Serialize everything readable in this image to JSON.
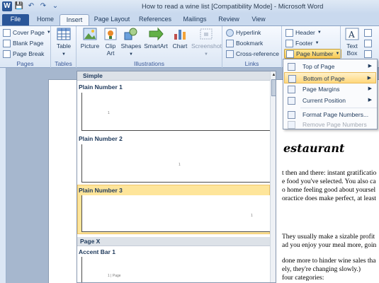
{
  "window": {
    "title": "How to read a wine list [Compatibility Mode] - Microsoft Word"
  },
  "qat": {
    "logo": "W",
    "save": "💾",
    "undo": "↶",
    "redo": "↷",
    "more": "⌄"
  },
  "tabs": [
    "File",
    "Home",
    "Insert",
    "Page Layout",
    "References",
    "Mailings",
    "Review",
    "View"
  ],
  "ribbon": {
    "pages": {
      "cover_page": "Cover Page",
      "blank_page": "Blank Page",
      "page_break": "Page Break",
      "label": "Pages"
    },
    "tables": {
      "table": "Table",
      "label": "Tables"
    },
    "illustrations": {
      "picture": "Picture",
      "clip_art": "Clip\nArt",
      "shapes": "Shapes",
      "smartart": "SmartArt",
      "chart": "Chart",
      "screenshot": "Screenshot",
      "label": "Illustrations"
    },
    "links": {
      "hyperlink": "Hyperlink",
      "bookmark": "Bookmark",
      "cross_reference": "Cross-reference",
      "label": "Links"
    },
    "header_footer": {
      "header": "Header",
      "footer": "Footer",
      "page_number": "Page Number"
    },
    "text": {
      "text_box": "Text\nBox"
    }
  },
  "gallery": {
    "section1": "Simple",
    "items": [
      "Plain Number 1",
      "Plain Number 2",
      "Plain Number 3"
    ],
    "section2": "Page X",
    "item4": "Accent Bar 1",
    "thumb_num": "1",
    "accent_text": "1 | Page"
  },
  "page_number_menu": {
    "items": [
      "Top of Page",
      "Bottom of Page",
      "Page Margins",
      "Current Position",
      "Format Page Numbers...",
      "Remove Page Numbers"
    ]
  },
  "document": {
    "title": "estaurant",
    "lines": [
      "t then and there: instant gratificatio",
      "e food you've selected. You also ca",
      "o home feeling good about yoursel",
      "oractice does make perfect, at least",
      "They usually make a sizable profit",
      "ad you enjoy your meal more, goin",
      "done more to hinder wine sales tha",
      "ely, they're changing slowly.)",
      "four categories:"
    ]
  },
  "colors": {
    "file_tab": "#2a5699",
    "selected": "#fee59a",
    "menu_hover": "#ffd77c"
  }
}
